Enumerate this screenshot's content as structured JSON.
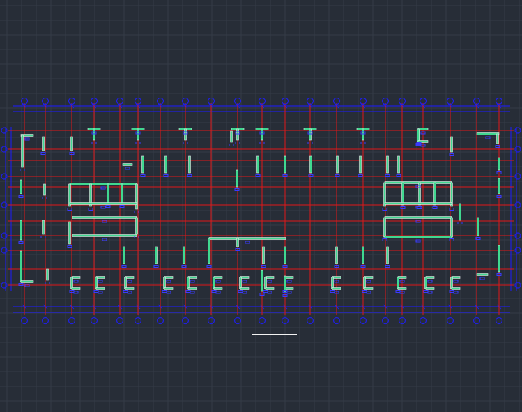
{
  "app": {
    "view": "model-space",
    "background_color": "#272d37"
  },
  "drawing": {
    "type": "structural-floor-plan",
    "axis_count_x": 20,
    "axis_count_y": 11,
    "colors": {
      "grid": "#343b47",
      "axis_lines": "#e01818",
      "dimension_lines": "#2020e0",
      "walls": "#40d890",
      "wall_outline": "#e8e8e8",
      "column_markers": "#3a3aff",
      "scale_bar": "#f2f2f2"
    },
    "icons": [
      "axis-bubble",
      "column-marker",
      "scale-bar"
    ]
  }
}
